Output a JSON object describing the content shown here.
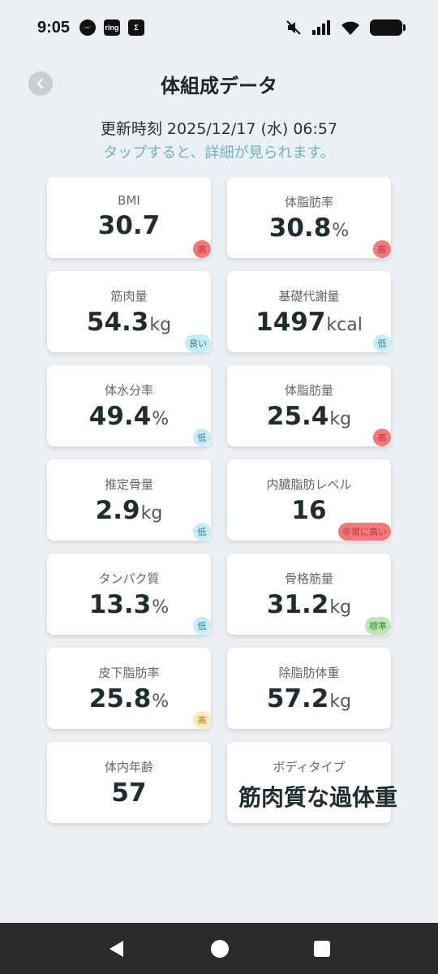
{
  "status_bar": {
    "time": "9:05",
    "apps": [
      "messenger",
      "ring",
      "Σ"
    ],
    "ring_label": "ring",
    "sigma_label": "Σ"
  },
  "header": {
    "title": "体組成データ"
  },
  "updated_text": "更新時刻 2025/12/17 (水) 06:57",
  "hint_text": "タップすると、詳細が見られます。",
  "metrics": [
    {
      "label": "BMI",
      "value": "30.7",
      "unit": "",
      "badge": "高",
      "badge_type": "high"
    },
    {
      "label": "体脂肪率",
      "value": "30.8",
      "unit": "%",
      "badge": "高",
      "badge_type": "high"
    },
    {
      "label": "筋肉量",
      "value": "54.3",
      "unit": "kg",
      "badge": "良い",
      "badge_type": "good"
    },
    {
      "label": "基礎代謝量",
      "value": "1497",
      "unit": "kcal",
      "badge": "低",
      "badge_type": "low"
    },
    {
      "label": "体水分率",
      "value": "49.4",
      "unit": "%",
      "badge": "低",
      "badge_type": "low"
    },
    {
      "label": "体脂肪量",
      "value": "25.4",
      "unit": "kg",
      "badge": "高",
      "badge_type": "high"
    },
    {
      "label": "推定骨量",
      "value": "2.9",
      "unit": "kg",
      "badge": "低",
      "badge_type": "low"
    },
    {
      "label": "内臓脂肪レベル",
      "value": "16",
      "unit": "",
      "badge": "非常に高い",
      "badge_type": "vhigh"
    },
    {
      "label": "タンパク質",
      "value": "13.3",
      "unit": "%",
      "badge": "低",
      "badge_type": "low"
    },
    {
      "label": "骨格筋量",
      "value": "31.2",
      "unit": "kg",
      "badge": "標準",
      "badge_type": "std"
    },
    {
      "label": "皮下脂肪率",
      "value": "25.8",
      "unit": "%",
      "badge": "高",
      "badge_type": "mid"
    },
    {
      "label": "除脂肪体重",
      "value": "57.2",
      "unit": "kg",
      "badge": "",
      "badge_type": ""
    },
    {
      "label": "体内年齢",
      "value": "57",
      "unit": "",
      "badge": "",
      "badge_type": ""
    },
    {
      "label": "ボディタイプ",
      "value": "筋肉質な過体重",
      "unit": "",
      "badge": "",
      "badge_type": "bodytype"
    }
  ],
  "colors": {
    "background": "#eaf0f3",
    "hint": "#6fb2bd",
    "badge_high": "#f4787a",
    "badge_low": "#c6ecf7",
    "badge_std": "#bce8b5",
    "badge_mid": "#fde9b8",
    "nav_bar": "#2b2b2b"
  },
  "nav": {
    "icons": [
      "back-triangle-icon",
      "home-circle-icon",
      "recents-square-icon"
    ]
  }
}
